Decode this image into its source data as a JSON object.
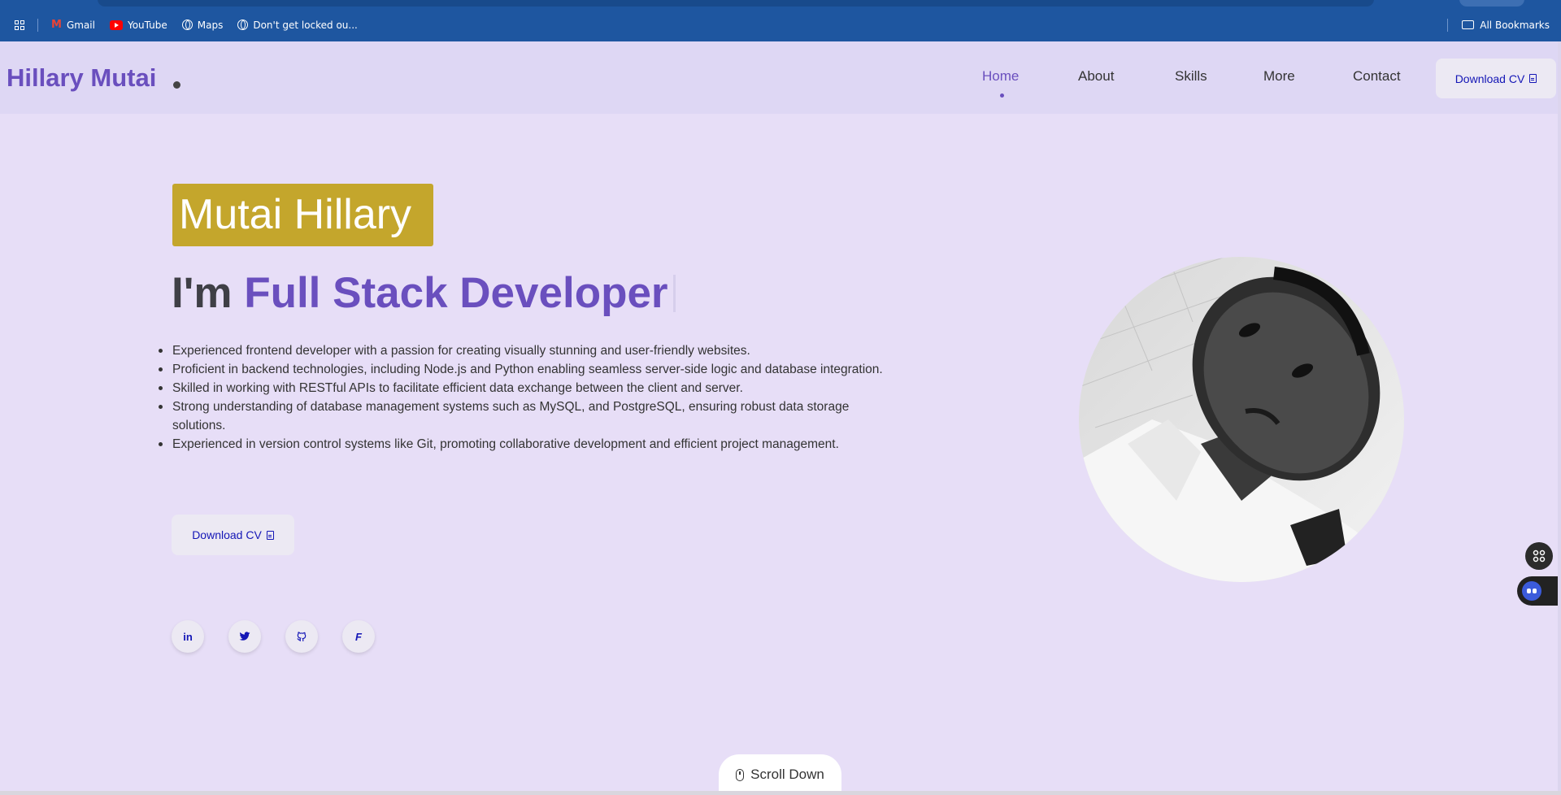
{
  "bookmarks_bar": {
    "items": [
      {
        "label": "Gmail",
        "icon": "gmail-icon"
      },
      {
        "label": "YouTube",
        "icon": "youtube-icon"
      },
      {
        "label": "Maps",
        "icon": "globe-icon"
      },
      {
        "label": "Don't get locked ou...",
        "icon": "globe-icon"
      }
    ],
    "all_bookmarks": "All Bookmarks"
  },
  "header": {
    "logo": "Hillary Mutai",
    "nav": [
      "Home",
      "About",
      "Skills",
      "More",
      "Contact"
    ],
    "active_nav": "Home",
    "download_cv": "Download CV"
  },
  "hero": {
    "name": "Mutai Hillary",
    "role_prefix": "I'm",
    "role": "Full Stack Developer",
    "bullets": [
      "Experienced frontend developer with a passion for creating visually stunning and user-friendly websites.",
      "Proficient in backend technologies, including Node.js and Python enabling seamless server-side logic and database integration.",
      "Skilled in working with RESTful APIs to facilitate efficient data exchange between the client and server.",
      "Strong understanding of database management systems such as MySQL, and PostgreSQL, ensuring robust data storage solutions.",
      "Experienced in version control systems like Git, promoting collaborative development and efficient project management."
    ],
    "download_cv": "Download CV",
    "social": [
      {
        "icon": "linkedin-icon",
        "glyph": "in"
      },
      {
        "icon": "twitter-icon",
        "glyph": ""
      },
      {
        "icon": "github-icon",
        "glyph": ""
      },
      {
        "icon": "facebook-icon",
        "glyph": "F"
      }
    ]
  },
  "scroll_down": "Scroll Down",
  "colors": {
    "accent": "#6a4fbe",
    "name_highlight": "#c4a62c",
    "background": "#e7def7",
    "link_blue": "#1416b6",
    "bookmarks_bar": "#1e56a0"
  }
}
